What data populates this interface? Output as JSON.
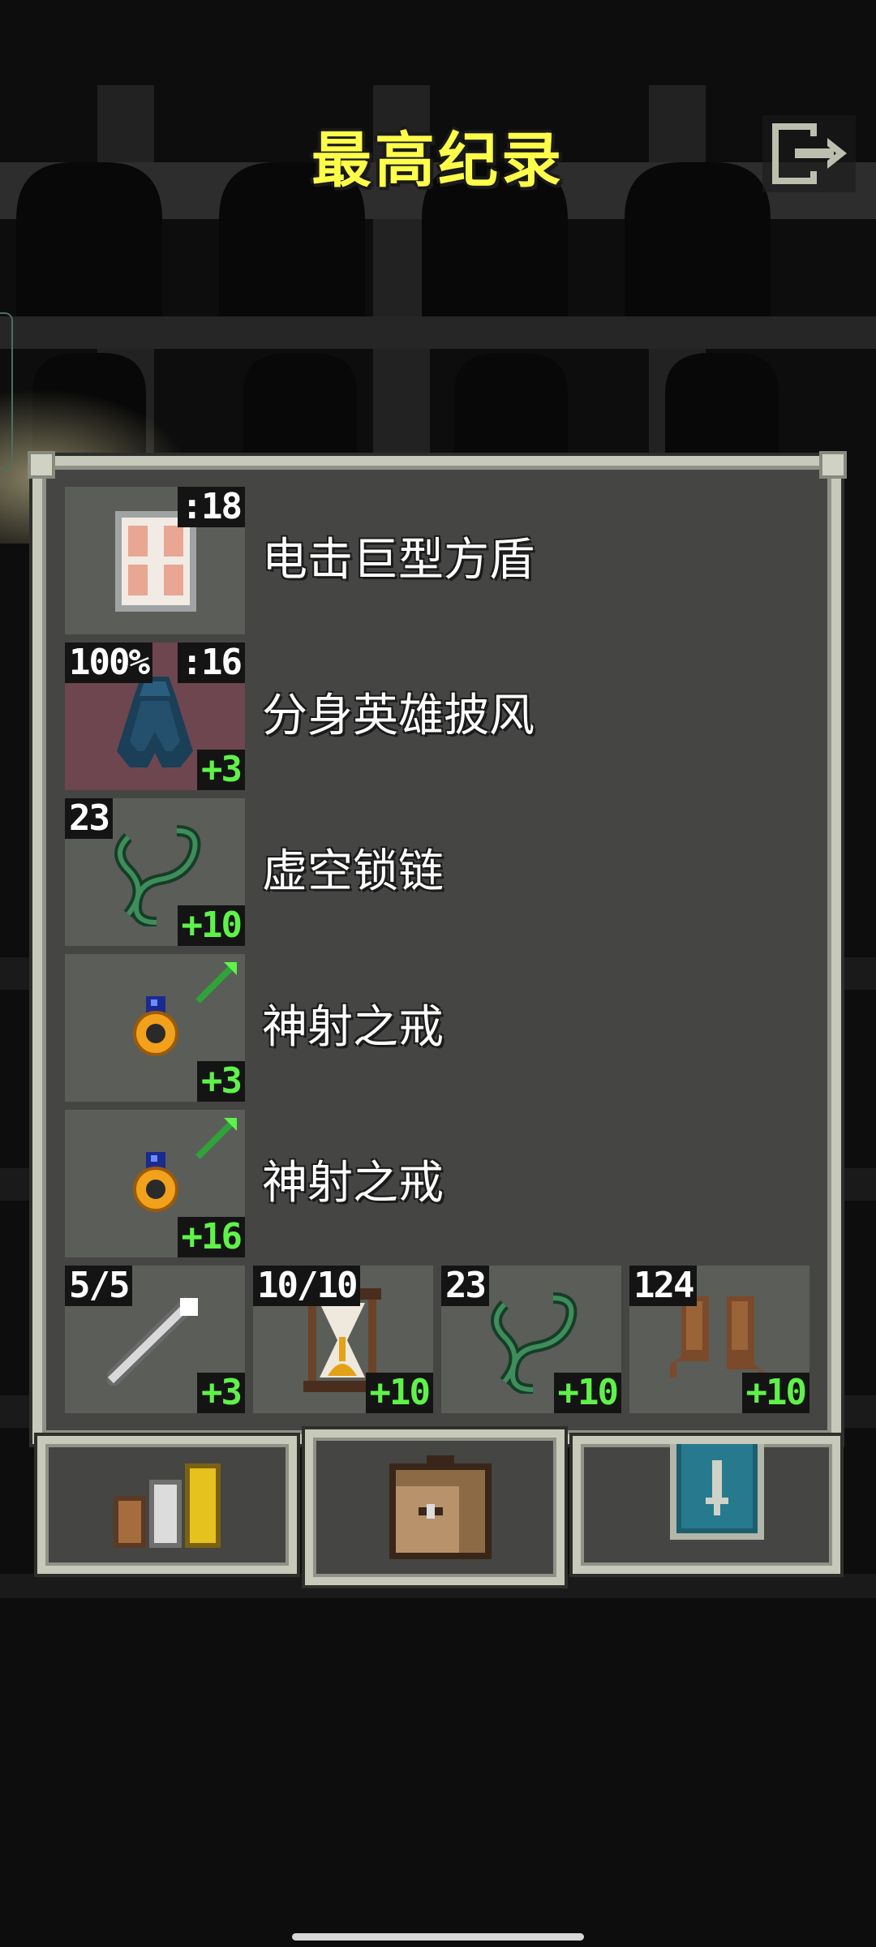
{
  "screen": {
    "title": "最高纪录"
  },
  "items": [
    {
      "name": "电击巨型方盾",
      "top_left": "",
      "top_right": ":18",
      "upgrade": "",
      "icon": "shield-icon"
    },
    {
      "name": "分身英雄披风",
      "top_left": "100%",
      "top_right": ":16",
      "upgrade": "+3",
      "icon": "cloak-icon"
    },
    {
      "name": "虚空锁链",
      "top_left": "23",
      "top_right": "",
      "upgrade": "+10",
      "icon": "chain-icon"
    },
    {
      "name": "神射之戒",
      "top_left": "",
      "top_right": "",
      "upgrade": "+3",
      "icon": "ring-icon"
    },
    {
      "name": "神射之戒",
      "top_left": "",
      "top_right": "",
      "upgrade": "+16",
      "icon": "ring-icon"
    }
  ],
  "quickslots": [
    {
      "top_left": "5/5",
      "upgrade": "+3",
      "icon": "wand-icon"
    },
    {
      "top_left": "10/10",
      "upgrade": "+10",
      "icon": "hourglass-icon"
    },
    {
      "top_left": "23",
      "upgrade": "+10",
      "icon": "chain-icon"
    },
    {
      "top_left": "124",
      "upgrade": "+10",
      "icon": "boots-icon"
    }
  ],
  "tabs": [
    {
      "icon": "stats-icon",
      "selected": false
    },
    {
      "icon": "backpack-icon",
      "selected": true
    },
    {
      "icon": "journal-icon",
      "selected": false
    }
  ],
  "colors": {
    "title": "#ffff4a",
    "panel_bg": "#454543",
    "panel_border": "#c7c9ba",
    "slot_bg": "#5b5d58",
    "upgrade_text": "#5ff24a"
  }
}
